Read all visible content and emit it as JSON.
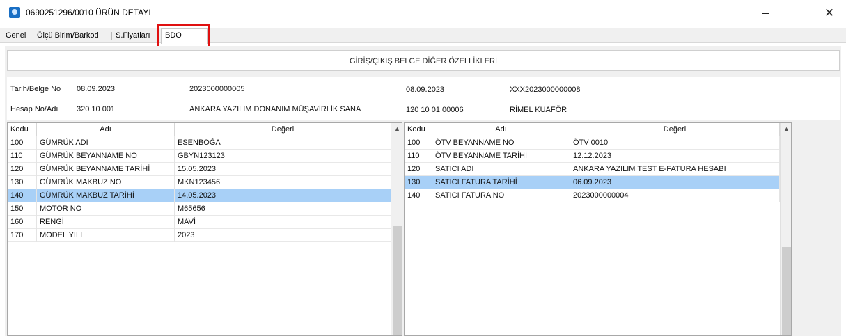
{
  "window": {
    "title": "0690251296/0010 ÜRÜN DETAYI",
    "minimize_glyph": "",
    "close_glyph": "✕"
  },
  "tabs": [
    {
      "label": "Genel"
    },
    {
      "label": "Ölçü Birim/Barkod"
    },
    {
      "label": "S.Fiyatları"
    },
    {
      "label": "BDO"
    }
  ],
  "section_title": "GİRİŞ/ÇIKIŞ BELGE DİĞER ÖZELLİKLERİ",
  "info": {
    "date_doc_label": "Tarih/Belge No",
    "date_left": "08.09.2023",
    "doc_no_left": "2023000000005",
    "date_right": "08.09.2023",
    "doc_no_right": "XXX2023000000008",
    "account_label": "Hesap No/Adı",
    "account_no_left": "320 10 001",
    "account_name_left": "ANKARA YAZILIM DONANIM MÜŞAVİRLİK SANA",
    "account_no_right": "120 10 01 00006",
    "account_name_right": "RİMEL KUAFÖR"
  },
  "left_grid": {
    "columns": [
      "Kodu",
      "Adı",
      "Değeri"
    ],
    "rows": [
      {
        "code": "100",
        "name": "GÜMRÜK ADI",
        "value": "ESENBOĞA"
      },
      {
        "code": "110",
        "name": "GÜMRÜK BEYANNAME NO",
        "value": "GBYN123123"
      },
      {
        "code": "120",
        "name": "GÜMRÜK BEYANNAME TARİHİ",
        "value": "15.05.2023"
      },
      {
        "code": "130",
        "name": "GÜMRÜK MAKBUZ NO",
        "value": "MKN123456"
      },
      {
        "code": "140",
        "name": "GÜMRÜK MAKBUZ TARİHİ",
        "value": "14.05.2023"
      },
      {
        "code": "150",
        "name": "MOTOR NO",
        "value": "M65656"
      },
      {
        "code": "160",
        "name": "RENGİ",
        "value": "MAVİ"
      },
      {
        "code": "170",
        "name": "MODEL YILI",
        "value": "2023"
      }
    ],
    "selected_row": 4
  },
  "right_grid": {
    "columns": [
      "Kodu",
      "Adı",
      "Değeri"
    ],
    "rows": [
      {
        "code": "100",
        "name": "ÖTV BEYANNAME NO",
        "value": "ÖTV 0010"
      },
      {
        "code": "110",
        "name": "ÖTV BEYANNAME TARİHİ",
        "value": "12.12.2023"
      },
      {
        "code": "120",
        "name": "SATICI ADI",
        "value": "ANKARA YAZILIM TEST E-FATURA HESABI"
      },
      {
        "code": "130",
        "name": "SATICI FATURA TARİHİ",
        "value": "06.09.2023"
      },
      {
        "code": "140",
        "name": "SATICI FATURA NO",
        "value": "2023000000004"
      }
    ],
    "selected_row": 3
  },
  "scroll_up_glyph": "▲",
  "colors": {
    "selection": "#a8d0f7",
    "highlight_border": "#e01010",
    "panel_bg": "#f0f0f0"
  }
}
